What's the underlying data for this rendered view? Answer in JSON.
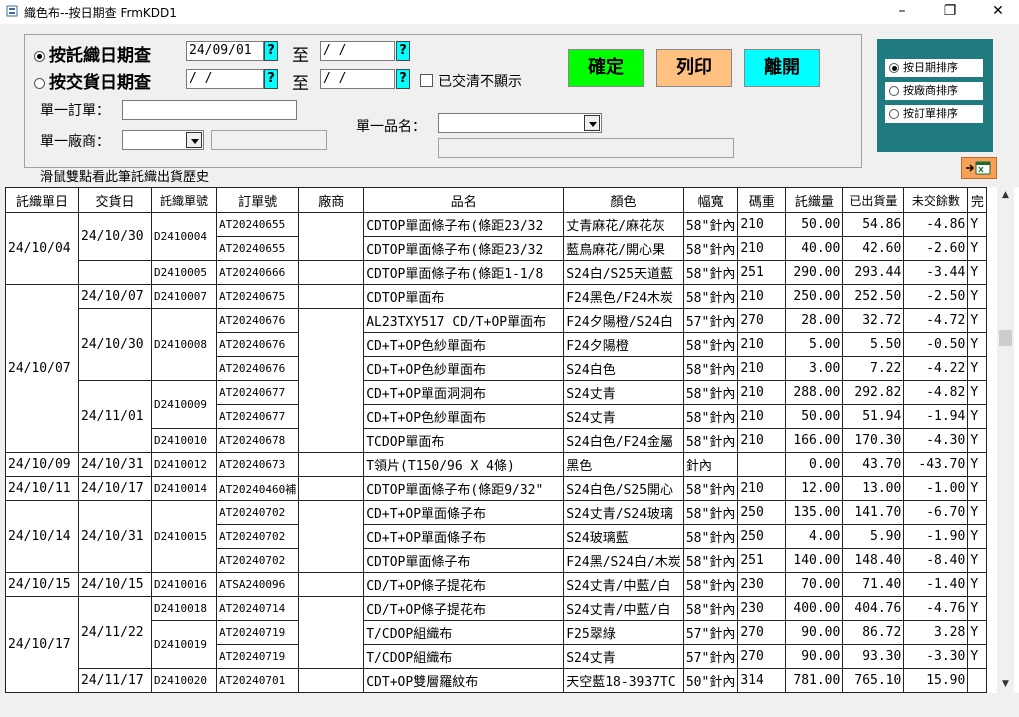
{
  "window": {
    "title": "織色布--按日期查 FrmKDD1",
    "minimize": "–",
    "restore": "❐",
    "close": "✕"
  },
  "form": {
    "radio_weave": "按託織日期查",
    "radio_delivery": "按交貨日期查",
    "weave_from": "24/09/01",
    "weave_to": " /  /",
    "delivery_from": " /  /",
    "delivery_to": " /  /",
    "to_label": "至",
    "q": "?",
    "hide_cleared": "已交清不顯示",
    "order_label": "單一訂單：",
    "vendor_label": "單一廠商：",
    "product_label": "單一品名："
  },
  "buttons": {
    "confirm": "確定",
    "print": "列印",
    "exit": "離開"
  },
  "sort": {
    "by_date": "按日期排序",
    "by_vendor": "按廠商排序",
    "by_order": "按訂單排序"
  },
  "hint": "滑鼠雙點看此筆託織出貨歷史",
  "colors": {
    "confirm": "#00ff00",
    "print": "#ffc080",
    "exit": "#00ffff",
    "sort_panel": "#1f7b80",
    "qbtn": "#00ffff"
  },
  "table": {
    "headers": [
      "託織單日",
      "交貨日",
      "託織單號",
      "訂單號",
      "廠商",
      "品名",
      "顏色",
      "幅寬",
      "碼重",
      "託織量",
      "已出貨量",
      "未交餘數",
      "完"
    ],
    "rows": [
      {
        "weave_date": "24/10/04",
        "delivery": "24/10/30",
        "weave_no": "D2410004",
        "order": "AT20240655",
        "vendor": "",
        "product": "CDTOP單面條子布(條距23/32",
        "color": "丈青麻花/麻花灰",
        "width": "58\"針內",
        "gsm": "210",
        "qty": "50.00",
        "shipped": "54.86",
        "remain": "-4.86",
        "done": "Y"
      },
      {
        "weave_date": "",
        "delivery": "",
        "weave_no": "",
        "order": "AT20240655",
        "vendor": "",
        "product": "CDTOP單面條子布(條距23/32",
        "color": "藍鳥麻花/開心果",
        "width": "58\"針內",
        "gsm": "210",
        "qty": "40.00",
        "shipped": "42.60",
        "remain": "-2.60",
        "done": "Y"
      },
      {
        "weave_date": "",
        "delivery": "",
        "weave_no": "D2410005",
        "order": "AT20240666",
        "vendor": "",
        "product": "CDTOP單面條子布(條距1-1/8",
        "color": "S24白/S25天道藍",
        "width": "58\"針內",
        "gsm": "251",
        "qty": "290.00",
        "shipped": "293.44",
        "remain": "-3.44",
        "done": "Y"
      },
      {
        "weave_date": "24/10/07",
        "delivery": "24/10/07",
        "weave_no": "D2410007",
        "order": "AT20240675",
        "vendor": "",
        "product": "CDTOP單面布",
        "color": "F24黑色/F24木炭",
        "width": "58\"針內",
        "gsm": "210",
        "qty": "250.00",
        "shipped": "252.50",
        "remain": "-2.50",
        "done": "Y"
      },
      {
        "weave_date": "",
        "delivery": "24/10/30",
        "weave_no": "D2410008",
        "order": "AT20240676",
        "vendor": "",
        "product": "AL23TXY517 CD/T+OP單面布",
        "color": "F24夕陽橙/S24白",
        "width": "57\"針內",
        "gsm": "270",
        "qty": "28.00",
        "shipped": "32.72",
        "remain": "-4.72",
        "done": "Y"
      },
      {
        "weave_date": "",
        "delivery": "",
        "weave_no": "",
        "order": "AT20240676",
        "vendor": "",
        "product": "CD+T+OP色紗單面布",
        "color": "F24夕陽橙",
        "width": "58\"針內",
        "gsm": "210",
        "qty": "5.00",
        "shipped": "5.50",
        "remain": "-0.50",
        "done": "Y"
      },
      {
        "weave_date": "",
        "delivery": "",
        "weave_no": "",
        "order": "AT20240676",
        "vendor": "",
        "product": "CD+T+OP色紗單面布",
        "color": "S24白色",
        "width": "58\"針內",
        "gsm": "210",
        "qty": "3.00",
        "shipped": "7.22",
        "remain": "-4.22",
        "done": "Y"
      },
      {
        "weave_date": "",
        "delivery": "24/11/01",
        "weave_no": "D2410009",
        "order": "AT20240677",
        "vendor": "",
        "product": "CD+T+OP單面洞洞布",
        "color": "S24丈青",
        "width": "58\"針內",
        "gsm": "210",
        "qty": "288.00",
        "shipped": "292.82",
        "remain": "-4.82",
        "done": "Y"
      },
      {
        "weave_date": "",
        "delivery": "",
        "weave_no": "",
        "order": "AT20240677",
        "vendor": "",
        "product": "CD+T+OP色紗單面布",
        "color": "S24丈青",
        "width": "58\"針內",
        "gsm": "210",
        "qty": "50.00",
        "shipped": "51.94",
        "remain": "-1.94",
        "done": "Y"
      },
      {
        "weave_date": "",
        "delivery": "",
        "weave_no": "D2410010",
        "order": "AT20240678",
        "vendor": "",
        "product": "TCDOP單面布",
        "color": "S24白色/F24金屬",
        "width": "58\"針內",
        "gsm": "210",
        "qty": "166.00",
        "shipped": "170.30",
        "remain": "-4.30",
        "done": "Y"
      },
      {
        "weave_date": "24/10/09",
        "delivery": "24/10/31",
        "weave_no": "D2410012",
        "order": "AT20240673",
        "vendor": "",
        "product": "T領片(T150/96 X 4條)",
        "color": "黑色",
        "width": "針內",
        "gsm": "",
        "qty": "0.00",
        "shipped": "43.70",
        "remain": "-43.70",
        "done": "Y"
      },
      {
        "weave_date": "24/10/11",
        "delivery": "24/10/17",
        "weave_no": "D2410014",
        "order": "AT20240460補",
        "vendor": "",
        "product": "CDTOP單面條子布(條距9/32\"",
        "color": "S24白色/S25開心",
        "width": "58\"針內",
        "gsm": "210",
        "qty": "12.00",
        "shipped": "13.00",
        "remain": "-1.00",
        "done": "Y"
      },
      {
        "weave_date": "24/10/14",
        "delivery": "24/10/31",
        "weave_no": "D2410015",
        "order": "AT20240702",
        "vendor": "",
        "product": "CD+T+OP單面條子布",
        "color": "S24丈青/S24玻璃",
        "width": "58\"針內",
        "gsm": "250",
        "qty": "135.00",
        "shipped": "141.70",
        "remain": "-6.70",
        "done": "Y"
      },
      {
        "weave_date": "",
        "delivery": "",
        "weave_no": "",
        "order": "AT20240702",
        "vendor": "",
        "product": "CD+T+OP單面條子布",
        "color": "S24玻璃藍",
        "width": "58\"針內",
        "gsm": "250",
        "qty": "4.00",
        "shipped": "5.90",
        "remain": "-1.90",
        "done": "Y"
      },
      {
        "weave_date": "",
        "delivery": "",
        "weave_no": "",
        "order": "AT20240702",
        "vendor": "",
        "product": "CDTOP單面條子布",
        "color": "F24黑/S24白/木炭",
        "width": "58\"針內",
        "gsm": "251",
        "qty": "140.00",
        "shipped": "148.40",
        "remain": "-8.40",
        "done": "Y"
      },
      {
        "weave_date": "24/10/15",
        "delivery": "24/10/15",
        "weave_no": "D2410016",
        "order": "ATSA240096",
        "vendor": "",
        "product": "CD/T+OP條子提花布",
        "color": "S24丈青/中藍/白",
        "width": "58\"針內",
        "gsm": "230",
        "qty": "70.00",
        "shipped": "71.40",
        "remain": "-1.40",
        "done": "Y"
      },
      {
        "weave_date": "24/10/17",
        "delivery": "24/11/22",
        "weave_no": "D2410018",
        "order": "AT20240714",
        "vendor": "",
        "product": "CD/T+OP條子提花布",
        "color": "S24丈青/中藍/白",
        "width": "58\"針內",
        "gsm": "230",
        "qty": "400.00",
        "shipped": "404.76",
        "remain": "-4.76",
        "done": "Y"
      },
      {
        "weave_date": "",
        "delivery": "",
        "weave_no": "D2410019",
        "order": "AT20240719",
        "vendor": "",
        "product": "T/CDOP組織布",
        "color": "F25翠綠",
        "width": "57\"針內",
        "gsm": "270",
        "qty": "90.00",
        "shipped": "86.72",
        "remain": "3.28",
        "done": "Y"
      },
      {
        "weave_date": "",
        "delivery": "",
        "weave_no": "",
        "order": "AT20240719",
        "vendor": "",
        "product": "T/CDOP組織布",
        "color": "S24丈青",
        "width": "57\"針內",
        "gsm": "270",
        "qty": "90.00",
        "shipped": "93.30",
        "remain": "-3.30",
        "done": "Y"
      },
      {
        "weave_date": "",
        "delivery": "24/11/17",
        "weave_no": "D2410020",
        "order": "AT20240701",
        "vendor": "",
        "product": "CDT+OP雙層羅紋布",
        "color": "天空藍18-3937TC",
        "width": "50\"針內",
        "gsm": "314",
        "qty": "781.00",
        "shipped": "765.10",
        "remain": "15.90",
        "done": ""
      }
    ]
  }
}
